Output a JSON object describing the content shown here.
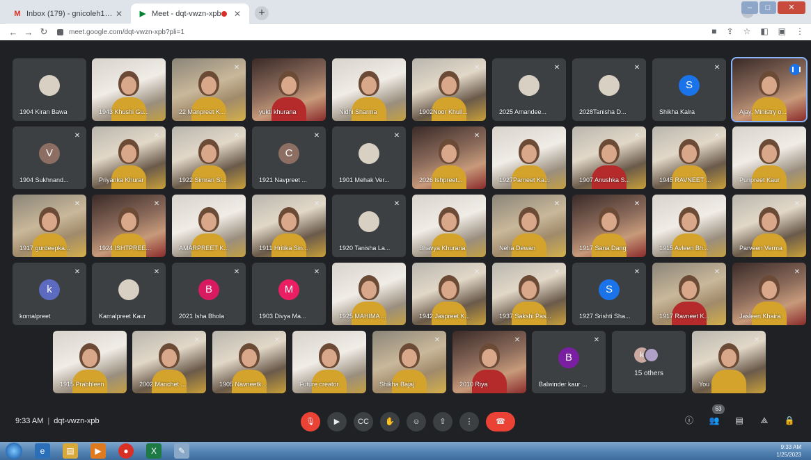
{
  "browser": {
    "tabs": [
      {
        "title": "Inbox (179) - gnicoleh1@gmail",
        "favicon": "gmail-icon",
        "favicon_color": "#d93025"
      },
      {
        "title": "Meet - dqt-vwzn-xpb",
        "favicon": "meet-icon",
        "favicon_color": "#00832d",
        "recording": true
      }
    ],
    "url": "meet.google.com/dqt-vwzn-xpb?pli=1"
  },
  "participants": [
    {
      "name": "1904 Kiran Bawa",
      "type": "image",
      "muted": false
    },
    {
      "name": "1943 Khushi Gu...",
      "type": "video",
      "muted": true
    },
    {
      "name": "22 Manpreet K...",
      "type": "video",
      "muted": true
    },
    {
      "name": "yukti khurana",
      "type": "video",
      "muted": false
    },
    {
      "name": "Nidhi Sharma",
      "type": "video",
      "muted": true
    },
    {
      "name": "1902Noor Khull...",
      "type": "video",
      "muted": true
    },
    {
      "name": "2025 Amandee...",
      "type": "image",
      "muted": true
    },
    {
      "name": "2028Tanisha D...",
      "type": "image",
      "muted": true
    },
    {
      "name": "Shikha Kalra",
      "type": "avatar",
      "letter": "S",
      "color": "#1a73e8",
      "muted": true
    },
    {
      "name": "Ajay, Ministry o...",
      "type": "video",
      "muted": false,
      "speaking": true
    },
    {
      "name": "1904 Sukhnand...",
      "type": "avatar",
      "letter": "V",
      "color": "#8d6e63",
      "muted": true
    },
    {
      "name": "Priyanka Khurar",
      "type": "video",
      "muted": true
    },
    {
      "name": "1922 Simran Si...",
      "type": "video",
      "muted": true
    },
    {
      "name": "1921 Navpreet ...",
      "type": "avatar",
      "letter": "C",
      "color": "#8d6e63",
      "muted": true
    },
    {
      "name": "1901 Mehak Ver...",
      "type": "image",
      "muted": true
    },
    {
      "name": "2026 Ishpreet...",
      "type": "video",
      "muted": true
    },
    {
      "name": "1927Parneet Ka...",
      "type": "video",
      "muted": true
    },
    {
      "name": "1907 Anushka S...",
      "type": "video",
      "muted": true
    },
    {
      "name": "1945 RAVNEET ...",
      "type": "video",
      "muted": true
    },
    {
      "name": "Punpreet Kaur",
      "type": "video",
      "muted": false
    },
    {
      "name": "1917 gurdeepka...",
      "type": "video",
      "muted": true
    },
    {
      "name": "1924 ISHTPREE...",
      "type": "video",
      "muted": true
    },
    {
      "name": "AMARPREET K...",
      "type": "video",
      "muted": true
    },
    {
      "name": "1911 Hritika Sin...",
      "type": "video",
      "muted": true
    },
    {
      "name": "1920 Tanisha La...",
      "type": "image",
      "muted": true
    },
    {
      "name": "Bhavya Khurana",
      "type": "video",
      "muted": true
    },
    {
      "name": "Neha Dewan",
      "type": "video",
      "muted": true
    },
    {
      "name": "1917 Sana Dang",
      "type": "video",
      "muted": true
    },
    {
      "name": "1915 Avleen Bh...",
      "type": "video",
      "muted": true
    },
    {
      "name": "Parveen Verma",
      "type": "video",
      "muted": true
    },
    {
      "name": "komalpreet",
      "type": "avatar",
      "letter": "k",
      "color": "#5c6bc0",
      "muted": true
    },
    {
      "name": "Kamalpreet Kaur",
      "type": "image",
      "muted": true
    },
    {
      "name": "2021 Isha Bhola",
      "type": "avatar",
      "letter": "B",
      "color": "#d81b60",
      "muted": true
    },
    {
      "name": "1903 Divya Ma...",
      "type": "avatar",
      "letter": "M",
      "color": "#e91e63",
      "muted": true
    },
    {
      "name": "1925 MAHIMA ...",
      "type": "video",
      "muted": true
    },
    {
      "name": "1942 Jaspreet K...",
      "type": "video",
      "muted": true
    },
    {
      "name": "1937 Sakshi Pas...",
      "type": "video",
      "muted": true
    },
    {
      "name": "1927 Srishti Sha...",
      "type": "avatar",
      "letter": "S",
      "color": "#1a73e8",
      "muted": true
    },
    {
      "name": "1917 Ravneet K...",
      "type": "video",
      "muted": true
    },
    {
      "name": "Jasleen Khaira",
      "type": "video",
      "muted": true
    },
    {
      "name": "1915 Prabhleen",
      "type": "video",
      "muted": true
    },
    {
      "name": "2002 Manchet ...",
      "type": "video",
      "muted": true
    },
    {
      "name": "1905 Navneetk...",
      "type": "video",
      "muted": true
    },
    {
      "name": "Future creator.",
      "type": "video",
      "muted": true
    },
    {
      "name": "Shikha Bajaj",
      "type": "video",
      "muted": true
    },
    {
      "name": "2010 Riya",
      "type": "video",
      "muted": true
    },
    {
      "name": "Balwinder kaur ...",
      "type": "avatar",
      "letter": "B",
      "color": "#7b1fa2",
      "muted": true
    },
    {
      "name": "15 others",
      "type": "others",
      "letter": "k",
      "muted": false
    },
    {
      "name": "You",
      "type": "video",
      "muted": true
    }
  ],
  "meeting": {
    "time": "9:33 AM",
    "separator": "|",
    "code": "dqt-vwzn-xpb",
    "participant_count": "63"
  },
  "taskbar": {
    "time": "9:33 AM",
    "date": "1/25/2023"
  },
  "colors": {
    "background": "#202124",
    "tile": "#3c4043",
    "hangup": "#ea4335",
    "accent": "#8ab4f8"
  }
}
